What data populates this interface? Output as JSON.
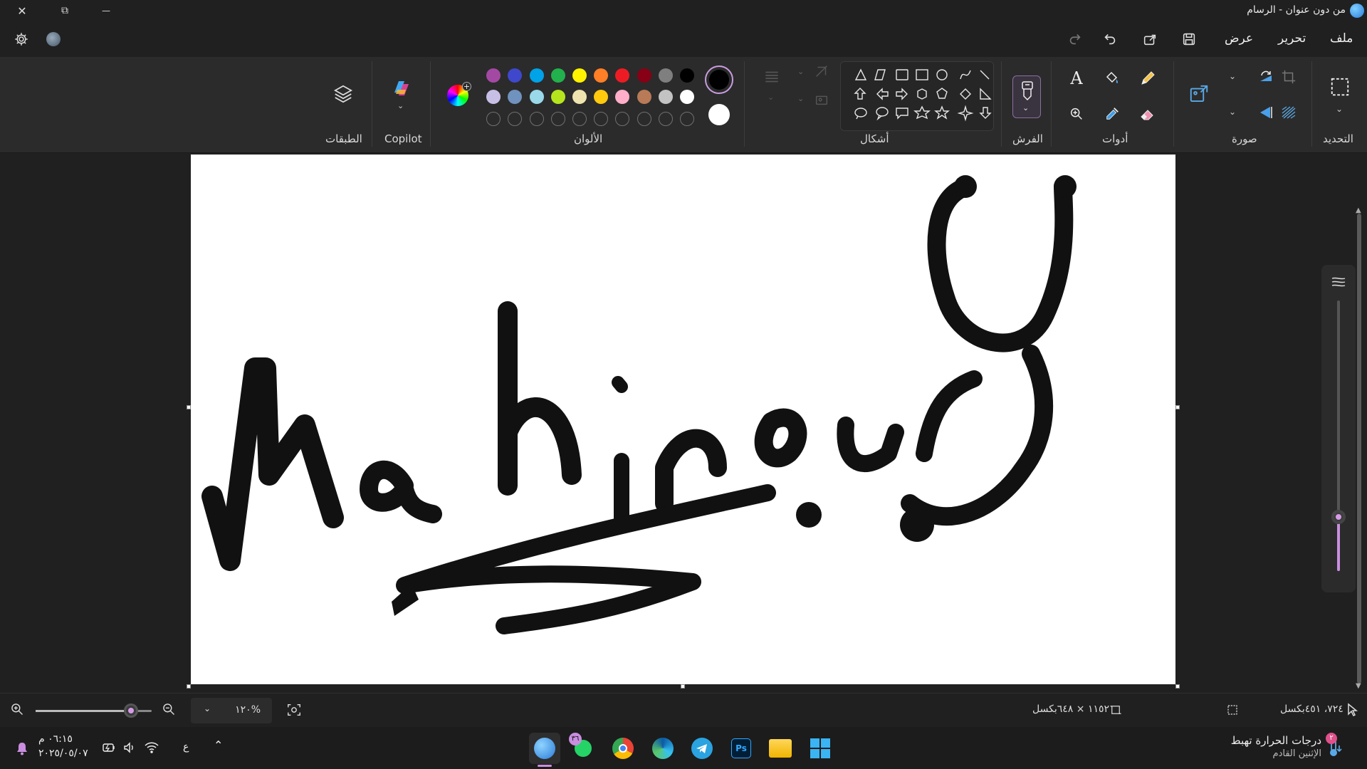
{
  "window": {
    "title": "من دون عنوان - الرسام",
    "close_glyph": "✕",
    "restore_glyph": "⧉",
    "minimize_glyph": "—"
  },
  "menu": {
    "file": "ملف",
    "edit": "تحرير",
    "view": "عرض"
  },
  "ribbon": {
    "groups": {
      "selection": "التحديد",
      "image": "صورة",
      "tools": "أدوات",
      "brushes": "الفرش",
      "shapes": "أشكال",
      "colors": "الألوان",
      "copilot": "Copilot",
      "layers": "الطبقات"
    },
    "text_tool_glyph": "A",
    "primary_color": "#000000",
    "secondary_color": "#ffffff",
    "palette": [
      [
        "#000000",
        "#7f7f7f",
        "#880015",
        "#ed1c24",
        "#ff7f27",
        "#fff200",
        "#22b14c",
        "#00a2e8",
        "#3f48cc",
        "#a349a4"
      ],
      [
        "#ffffff",
        "#c3c3c3",
        "#b97a57",
        "#ffaec9",
        "#ffc90e",
        "#efe4b0",
        "#b5e61d",
        "#99d9ea",
        "#7092be",
        "#c8bfe7"
      ]
    ],
    "custom_slots": 10
  },
  "status": {
    "cursor_pos": "٧٢٤، ٤٥١بكسل",
    "canvas_size": "١١٥٢ × ٦٤٨بكسل",
    "zoom": "١٢٠%",
    "zoom_level_fraction": 0.82
  },
  "taskbar": {
    "weather_title": "درجات الحرارة تهبط",
    "weather_sub": "الإثنين القادم",
    "weather_badge": "٢",
    "time": "٠٦:١٥ م",
    "date": "٢٠٢٥/٠٥/٠٧",
    "lang": "ع",
    "whatsapp_badge": "٣٦"
  },
  "canvas_label": "Mahinour",
  "brush_size_fraction": 0.2
}
